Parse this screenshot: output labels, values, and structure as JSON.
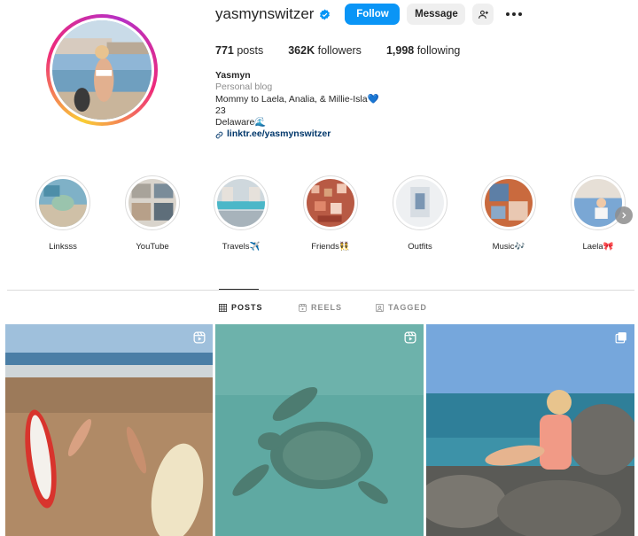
{
  "profile": {
    "username": "yasmynswitzer",
    "verified": true,
    "follow_label": "Follow",
    "message_label": "Message",
    "stats": {
      "posts_count": "771",
      "posts_label": "posts",
      "followers_count": "362K",
      "followers_label": "followers",
      "following_count": "1,998",
      "following_label": "following"
    },
    "bio": {
      "name": "Yasmyn",
      "category": "Personal blog",
      "line1": "Mommy to Laela, Analia, & Millie-Isla💙",
      "line2": "23",
      "line3": "Delaware🌊",
      "link": "linktr.ee/yasmynswitzer"
    }
  },
  "highlights": [
    {
      "label": "Linksss"
    },
    {
      "label": "YouTube"
    },
    {
      "label": "Travels✈️"
    },
    {
      "label": "Friends👯"
    },
    {
      "label": "Outfits"
    },
    {
      "label": "Music🎶"
    },
    {
      "label": "Laela🎀"
    }
  ],
  "tabs": {
    "posts": "POSTS",
    "reels": "REELS",
    "tagged": "TAGGED"
  },
  "icons": {
    "verified": "verified-badge-icon",
    "suggest": "add-person-icon",
    "more": "more-options-icon",
    "link": "link-icon",
    "reel": "reel-icon",
    "carousel": "carousel-icon"
  },
  "colors": {
    "accent": "#0a95f6",
    "link": "#00376b",
    "muted": "#8e8e8e"
  }
}
